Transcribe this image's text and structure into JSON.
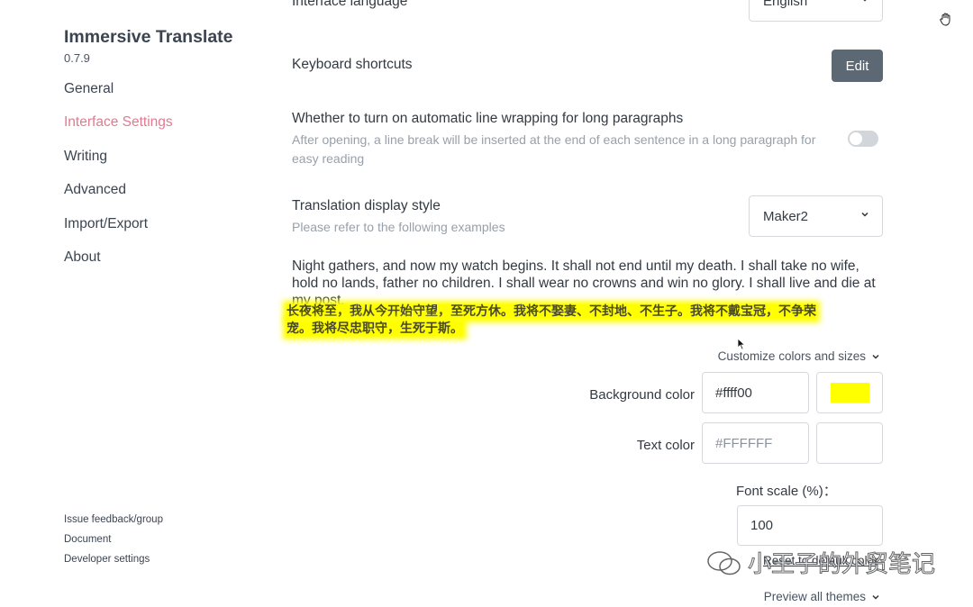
{
  "sidebar": {
    "title": "Immersive Translate",
    "version": "0.7.9",
    "nav": [
      "General",
      "Interface Settings",
      "Writing",
      "Advanced",
      "Import/Export",
      "About"
    ],
    "active_index": 1,
    "footer": [
      "Issue feedback/group",
      "Document",
      "Developer settings"
    ]
  },
  "settings": {
    "interface_language": {
      "label": "Interface language",
      "value": "English"
    },
    "keyboard_shortcuts": {
      "label": "Keyboard shortcuts",
      "button": "Edit"
    },
    "line_wrap": {
      "label": "Whether to turn on automatic line wrapping for long paragraphs",
      "description": "After opening, a line break will be inserted at the end of each sentence in a long paragraph for easy reading",
      "enabled": false
    },
    "display_style": {
      "label": "Translation display style",
      "description": "Please refer to the following examples",
      "value": "Maker2"
    }
  },
  "example": {
    "english": "Night gathers, and now my watch begins. It shall not end until my death. I shall take no wife, hold no lands, father no children. I shall wear no crowns and win no glory. I shall live and die at my post.",
    "chinese_line1": "长夜将至，我从今开始守望，至死方休。我将不娶妻、不封地、不生子。我将不戴宝冠，不争荣",
    "chinese_line2": "宠。我将尽忠职守，生死于斯。"
  },
  "customize": {
    "toggle_label": "Customize colors and sizes",
    "background_color": {
      "label": "Background color",
      "value": "#ffff00",
      "swatch": "#ffff00"
    },
    "text_color": {
      "label": "Text color",
      "placeholder": "#FFFFFF"
    },
    "font_scale": {
      "label": "Font scale (%)：",
      "value": "100"
    },
    "reset": "Reset to default color"
  },
  "preview_all_themes": "Preview all themes",
  "watermark": "小王子的外贸笔记",
  "colors": {
    "accent": "#e07a92",
    "edit_button": "#5c6874",
    "highlight": "#ffff00"
  }
}
